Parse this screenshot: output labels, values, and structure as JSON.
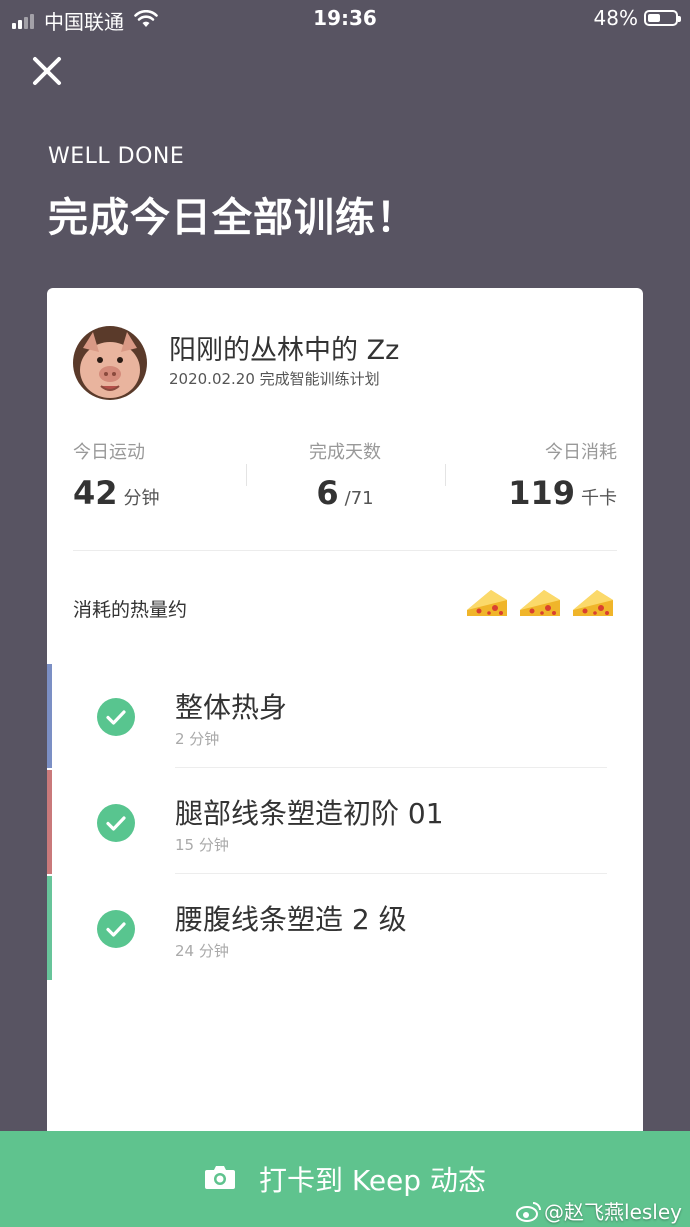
{
  "status_bar": {
    "carrier": "中国联通",
    "time": "19:36",
    "battery": "48%",
    "battery_level": 0.48
  },
  "header": {
    "eyebrow": "WELL DONE",
    "title": "完成今日全部训练！"
  },
  "card": {
    "user": {
      "name": "阳刚的丛林中的 Zz",
      "subline": "2020.02.20 完成智能训练计划"
    },
    "stats": [
      {
        "label": "今日运动",
        "value": "42",
        "unit": "分钟"
      },
      {
        "label": "完成天数",
        "value": "6",
        "unit": "/71"
      },
      {
        "label": "今日消耗",
        "value": "119",
        "unit": "千卡"
      }
    ],
    "calorie_label": "消耗的热量约",
    "calorie_icon_count": 3,
    "sessions": [
      {
        "title": "整体热身",
        "duration": "2 分钟",
        "color": "#7b8fc4"
      },
      {
        "title": "腿部线条塑造初阶 01",
        "duration": "15 分钟",
        "color": "#c9797a"
      },
      {
        "title": "腰腹线条塑造 2 级",
        "duration": "24 分钟",
        "color": "#67c49a"
      }
    ]
  },
  "checkin_button": {
    "label": "打卡到 Keep 动态"
  },
  "watermark": "@赵飞燕lesley",
  "colors": {
    "background": "#585462",
    "accent_green": "#5fc38e",
    "check_green": "#58c58f"
  }
}
